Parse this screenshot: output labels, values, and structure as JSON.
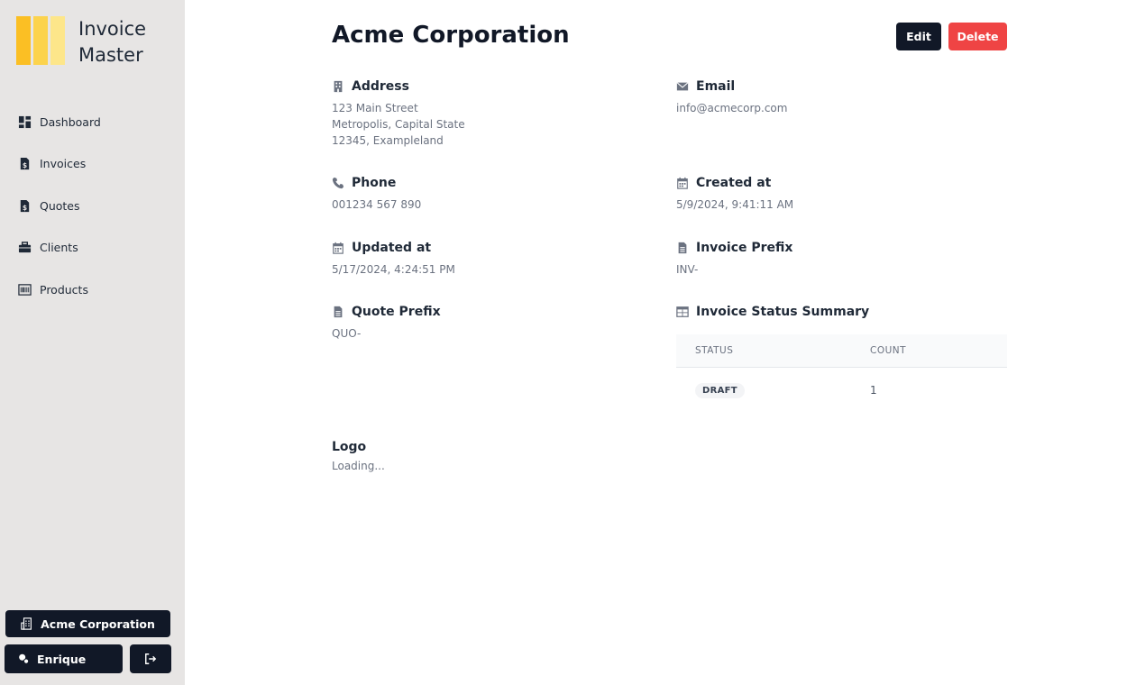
{
  "brand": {
    "name": "Invoice Master",
    "colors": [
      "#fbbf24",
      "#fcd34d",
      "#fde68a"
    ]
  },
  "sidebar": {
    "items": [
      {
        "label": "Dashboard",
        "icon": "dashboard-icon"
      },
      {
        "label": "Invoices",
        "icon": "invoice-file-icon"
      },
      {
        "label": "Quotes",
        "icon": "quote-file-icon"
      },
      {
        "label": "Clients",
        "icon": "briefcase-icon"
      },
      {
        "label": "Products",
        "icon": "barcode-icon"
      }
    ],
    "company_button": "Acme Corporation",
    "user_button": "Enrique"
  },
  "page": {
    "title": "Acme Corporation",
    "edit_label": "Edit",
    "delete_label": "Delete",
    "delete_color": "#ef4444"
  },
  "fields": {
    "address": {
      "label": "Address",
      "lines": [
        "123 Main Street",
        "Metropolis, Capital State",
        "12345, Exampleland"
      ]
    },
    "email": {
      "label": "Email",
      "value": "info@acmecorp.com"
    },
    "phone": {
      "label": "Phone",
      "value": "001234 567 890"
    },
    "created_at": {
      "label": "Created at",
      "value": "5/9/2024, 9:41:11 AM"
    },
    "updated_at": {
      "label": "Updated at",
      "value": "5/17/2024, 4:24:51 PM"
    },
    "invoice_prefix": {
      "label": "Invoice Prefix",
      "value": "INV-"
    },
    "quote_prefix": {
      "label": "Quote Prefix",
      "value": "QUO-"
    }
  },
  "status_summary": {
    "label": "Invoice Status Summary",
    "headers": [
      "STATUS",
      "COUNT"
    ],
    "rows": [
      {
        "status": "DRAFT",
        "count": "1"
      }
    ]
  },
  "logo": {
    "label": "Logo",
    "value": "Loading..."
  }
}
